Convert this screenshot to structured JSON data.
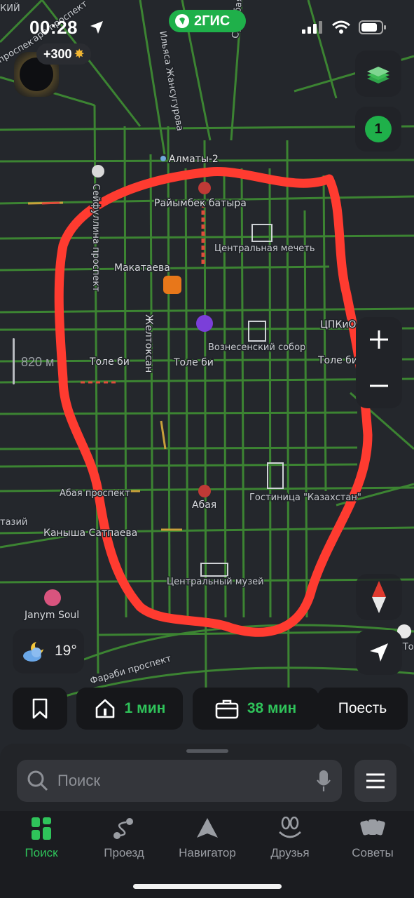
{
  "status_bar": {
    "time": "00:28",
    "brand": "2ГИС",
    "points": "+300"
  },
  "map": {
    "labels": {
      "top_left": "КИЙ",
      "prospect_tl": "проспект",
      "prospect_tl2": "ара проспект",
      "zhansugurov": "Ильяса Жансугурова",
      "suyunbai": "Суюнбая проспект",
      "almaty2": "Алматы-2",
      "seifullin": "Сейфуллина проспект",
      "raimbek": "Райымбек батыра",
      "mosque": "Центральная мечеть",
      "makataev": "Макатаева",
      "zheltoksan": "Желтоксан",
      "cathedral": "Вознесенский собор",
      "tsp": "ЦПКиО",
      "tole_bi_1": "Толе би",
      "tole_bi_2": "Толе би",
      "tole_bi_3": "Толе би",
      "abai_prospect": "Абая проспект",
      "abai_station": "Абая",
      "hotel": "Гостиница \"Казахстан\"",
      "tazy": "тазий",
      "kanysh": "Каныша Сатпаева",
      "museum": "Центральный музей",
      "janym": "Janym Soul",
      "farabi": "Фараби проспект",
      "right_edge": "-То"
    },
    "scale": "820 м"
  },
  "controls": {
    "badge_count": "1",
    "weather_temp": "19°"
  },
  "quick": {
    "home_time": "1 мин",
    "work_time": "38 мин",
    "eat_label": "Поесть"
  },
  "search": {
    "placeholder": "Поиск"
  },
  "tabs": [
    {
      "label": "Поиск"
    },
    {
      "label": "Проезд"
    },
    {
      "label": "Навигатор"
    },
    {
      "label": "Друзья"
    },
    {
      "label": "Советы"
    }
  ],
  "colors": {
    "accent": "#2fc35a",
    "annotation": "#ff3b30",
    "road": "#4fa63a"
  }
}
